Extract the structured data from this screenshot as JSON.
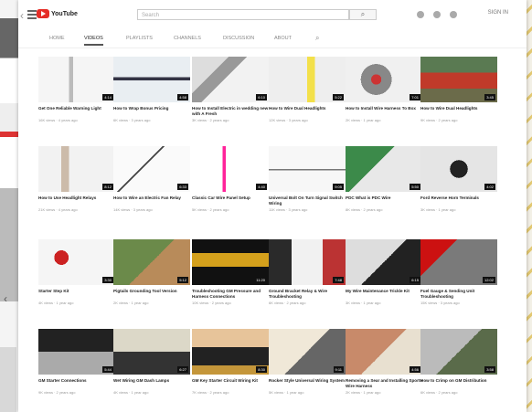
{
  "header": {
    "logo_text": "YouTube",
    "search_placeholder": "Search",
    "sign_in": "SIGN IN"
  },
  "tabs": [
    "Home",
    "Videos",
    "Playlists",
    "Channels",
    "Discussion",
    "About"
  ],
  "active_tab": 1,
  "videos": [
    {
      "title": "Get One Reliable Warning Light",
      "meta": "16K views · 4 years ago",
      "duration": "4:14"
    },
    {
      "title": "How to Wrap Bonus Pricing",
      "meta": "6K views · 3 years ago",
      "duration": "4:58"
    },
    {
      "title": "How to Install Electric in wedding new with A Fresh",
      "meta": "3K views · 2 years ago",
      "duration": "6:10"
    },
    {
      "title": "How to Wire Dual Headlights",
      "meta": "12K views · 3 years ago",
      "duration": "5:22"
    },
    {
      "title": "How to Install Wire Harness To Box",
      "meta": "2K views · 1 year ago",
      "duration": "7:01"
    },
    {
      "title": "How to Wire Dual Headlights",
      "meta": "9K views · 2 years ago",
      "duration": "3:45"
    },
    {
      "title": "How to Use Headlight Relays",
      "meta": "21K views · 4 years ago",
      "duration": "8:12"
    },
    {
      "title": "How to Wire an Electric Fan Relay",
      "meta": "14K views · 3 years ago",
      "duration": "6:33"
    },
    {
      "title": "Classic Car Wire Panel Setup",
      "meta": "5K views · 2 years ago",
      "duration": "4:40"
    },
    {
      "title": "Universal Bolt On Turn Signal Switch Wiring",
      "meta": "11K views · 3 years ago",
      "duration": "9:05"
    },
    {
      "title": "PDC What is PDC Wire",
      "meta": "8K views · 2 years ago",
      "duration": "5:50"
    },
    {
      "title": "Ford Reverse Horn Terminals",
      "meta": "3K views · 1 year ago",
      "duration": "4:02"
    },
    {
      "title": "Starter Step Kit",
      "meta": "4K views · 1 year ago",
      "duration": "3:30"
    },
    {
      "title": "Pigtails Grounding Tool Version",
      "meta": "2K views · 1 year ago",
      "duration": "5:12"
    },
    {
      "title": "Troubleshooting GM Pressure and Harness Connections",
      "meta": "10K views · 2 years ago",
      "duration": "11:20"
    },
    {
      "title": "Ground Bracket Relay & Wire Troubleshooting",
      "meta": "6K views · 2 years ago",
      "duration": "7:48"
    },
    {
      "title": "My Wire Maintenance Trickle Kit",
      "meta": "3K views · 1 year ago",
      "duration": "6:15"
    },
    {
      "title": "Fuel Gauge & Sending Unit Troubleshooting",
      "meta": "15K views · 3 years ago",
      "duration": "12:02"
    },
    {
      "title": "GM Starter Connections",
      "meta": "9K views · 2 years ago",
      "duration": "5:44"
    },
    {
      "title": "Wet Wiring GM Dash Lamps",
      "meta": "4K views · 1 year ago",
      "duration": "6:27"
    },
    {
      "title": "GM Key Starter Circuit Wiring Kit",
      "meta": "7K views · 2 years ago",
      "duration": "8:30"
    },
    {
      "title": "Rocker Style Universal Wiring System",
      "meta": "5K views · 1 year ago",
      "duration": "9:11"
    },
    {
      "title": "Removing a Sear and Installing Sports Wire Harness",
      "meta": "2K views · 1 year ago",
      "duration": "4:56"
    },
    {
      "title": "How to Crimp on GM Distribution",
      "meta": "6K views · 2 years ago",
      "duration": "3:58"
    }
  ]
}
